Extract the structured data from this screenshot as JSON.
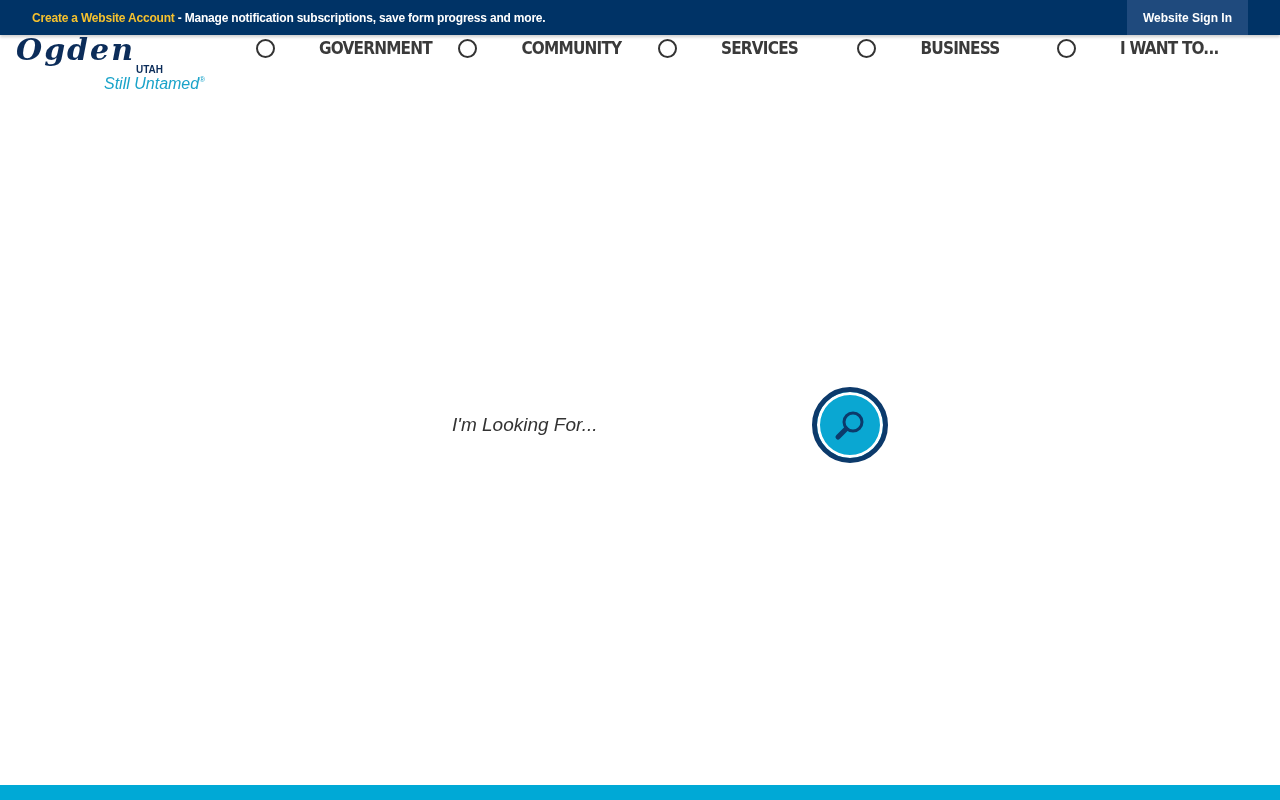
{
  "top_bar": {
    "link": "Create a Website Account",
    "message": " - Manage notification subscriptions, save form progress and more.",
    "sign_in": "Website Sign In"
  },
  "logo": {
    "name": "Ogden",
    "state": "UTAH",
    "tagline": "Still Untamed",
    "mark": "®"
  },
  "nav": [
    {
      "label": "GOVERNMENT"
    },
    {
      "label": "COMMUNITY"
    },
    {
      "label": "SERVICES"
    },
    {
      "label": "BUSINESS"
    },
    {
      "label": "I WANT TO..."
    }
  ],
  "search": {
    "placeholder": "I'm Looking For..."
  }
}
